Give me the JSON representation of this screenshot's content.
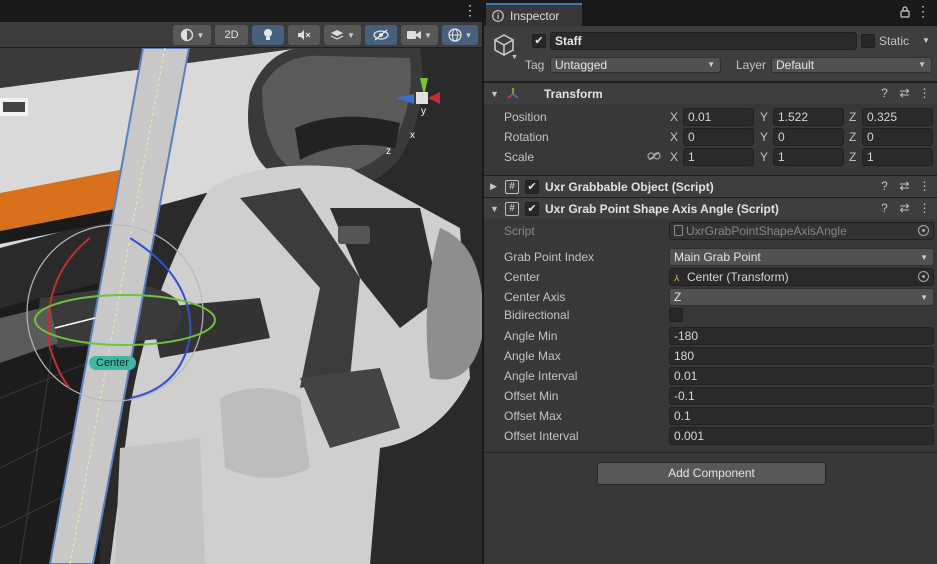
{
  "scene": {
    "toolbar": {
      "mode_2d": "2D"
    },
    "handle_label": "Center",
    "gizmo": {
      "x": "x",
      "y": "y",
      "z": "z"
    }
  },
  "inspector": {
    "tab_title": "Inspector",
    "gameobject": {
      "name": "Staff",
      "static_label": "Static",
      "tag_label": "Tag",
      "tag_value": "Untagged",
      "layer_label": "Layer",
      "layer_value": "Default"
    },
    "transform": {
      "title": "Transform",
      "position_label": "Position",
      "rotation_label": "Rotation",
      "scale_label": "Scale",
      "position": {
        "x": "0.01",
        "y": "1.522",
        "z": "0.325"
      },
      "rotation": {
        "x": "0",
        "y": "0",
        "z": "0"
      },
      "scale": {
        "x": "1",
        "y": "1",
        "z": "1"
      }
    },
    "grabbable": {
      "title": "Uxr Grabbable Object (Script)"
    },
    "shape_axis": {
      "title": "Uxr Grab Point Shape Axis Angle (Script)",
      "rows": {
        "script": {
          "label": "Script",
          "value": "UxrGrabPointShapeAxisAngle"
        },
        "grab_point_index": {
          "label": "Grab Point Index",
          "value": "Main Grab Point"
        },
        "center": {
          "label": "Center",
          "value": "Center (Transform)"
        },
        "center_axis": {
          "label": "Center Axis",
          "value": "Z"
        },
        "bidirectional": {
          "label": "Bidirectional"
        },
        "angle_min": {
          "label": "Angle Min",
          "value": "-180"
        },
        "angle_max": {
          "label": "Angle Max",
          "value": "180"
        },
        "angle_interval": {
          "label": "Angle Interval",
          "value": "0.01"
        },
        "offset_min": {
          "label": "Offset Min",
          "value": "-0.1"
        },
        "offset_max": {
          "label": "Offset Max",
          "value": "0.1"
        },
        "offset_interval": {
          "label": "Offset Interval",
          "value": "0.001"
        }
      }
    },
    "add_component": "Add Component"
  },
  "colors": {
    "accent": "#3a79bb",
    "center_label_bg": "#3eb7a3",
    "panel_bg": "#383838"
  }
}
